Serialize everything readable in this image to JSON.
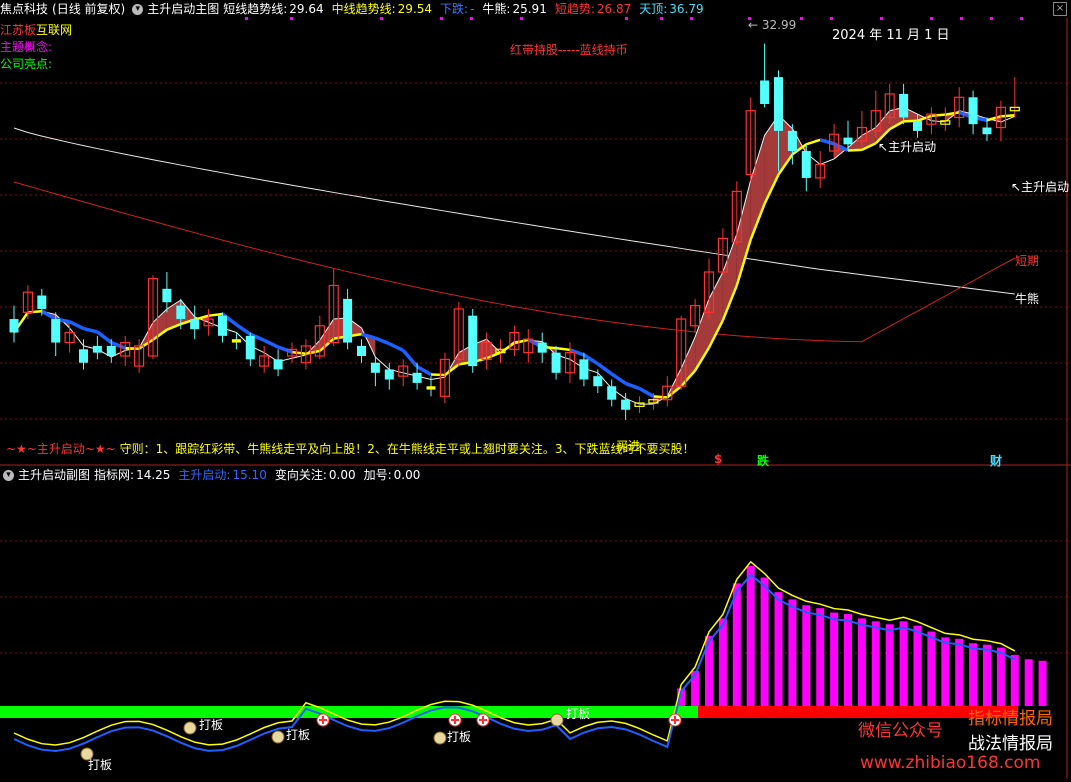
{
  "main_header": {
    "stock_name": "焦点科技",
    "mode": "(日线 前复权)",
    "indicator": "主升启动主图",
    "items": [
      {
        "label": "短线趋势线:",
        "value": "29.64",
        "color": "#ffffff"
      },
      {
        "label": "中线趋势线:",
        "value": "29.54",
        "color": "#ffff00"
      },
      {
        "label": "下跌:",
        "value": "-",
        "color": "#3a78ff"
      },
      {
        "label": "牛熊:",
        "value": "25.91",
        "color": "#ffffff"
      },
      {
        "label": "短趋势:",
        "value": "26.87",
        "color": "#ff3333"
      },
      {
        "label": "天顶:",
        "value": "36.79",
        "color": "#40e0ff"
      }
    ]
  },
  "side_labels": {
    "region_label": "江苏板",
    "region_value": "互联网",
    "theme": "主题概念:",
    "highlight": "公司亮点:"
  },
  "annotations": {
    "top_price": "32.99",
    "date": "2024 年 11 月 1 日",
    "hold_hint": "红带持股-----蓝线持币",
    "start_label_1": "主升启动",
    "start_label_2": "主升启动",
    "short_term": "短期",
    "bull_bear": "牛熊",
    "rule_prefix": "~★~主升启动~★~",
    "rule_text": "守则：1、跟踪红彩带、牛熊线走平及向上股！2、在牛熊线走平或上翘时要关注。3、下跌蓝线时不要买股！",
    "rule_overlay": "买进",
    "marker_dollar": "$",
    "marker_fall": "跌",
    "marker_wealth": "财"
  },
  "sub_header": {
    "indicator": "主升启动副图",
    "items": [
      {
        "label": "指标网:",
        "value": "14.25",
        "color": "#ffffff"
      },
      {
        "label": "主升启动:",
        "value": "15.10",
        "color": "#3366ff"
      },
      {
        "label": "变向关注:",
        "value": "0.00",
        "color": "#ffffff"
      },
      {
        "label": "加号:",
        "value": "0.00",
        "color": "#ffffff"
      }
    ]
  },
  "sub_annotations": {
    "daban": "打板",
    "watermark_1": "微信公众号",
    "watermark_2": "指标情报局",
    "watermark_3": "战法情报局",
    "watermark_url": "www.zhibiao168.com"
  },
  "colors": {
    "up": "#ff3030",
    "down": "#54ffff",
    "yellow": "#ffff00",
    "blue": "#1e60ff",
    "band": "#a53a3a",
    "magenta": "#ff00ff",
    "green_band": "#00ff00",
    "red_band": "#ff0000"
  },
  "chart_data": {
    "type": "candlestick",
    "candles": [
      {
        "o": 29.6,
        "c": 29.2,
        "h": 30.0,
        "l": 28.9
      },
      {
        "o": 29.8,
        "c": 30.4,
        "h": 30.6,
        "l": 29.6
      },
      {
        "o": 30.3,
        "c": 29.9,
        "h": 30.5,
        "l": 29.7
      },
      {
        "o": 29.6,
        "c": 28.9,
        "h": 29.8,
        "l": 28.5
      },
      {
        "o": 28.9,
        "c": 29.2,
        "h": 29.4,
        "l": 28.6
      },
      {
        "o": 28.7,
        "c": 28.3,
        "h": 29.0,
        "l": 28.1
      },
      {
        "o": 28.8,
        "c": 28.6,
        "h": 29.1,
        "l": 28.4
      },
      {
        "o": 28.8,
        "c": 28.5,
        "h": 29.0,
        "l": 28.3
      },
      {
        "o": 28.5,
        "c": 28.9,
        "h": 29.1,
        "l": 28.2
      },
      {
        "o": 28.2,
        "c": 28.8,
        "h": 29.0,
        "l": 28.0
      },
      {
        "o": 28.5,
        "c": 30.8,
        "h": 30.9,
        "l": 28.4
      },
      {
        "o": 30.5,
        "c": 30.1,
        "h": 31.0,
        "l": 29.8
      },
      {
        "o": 30.0,
        "c": 29.6,
        "h": 30.2,
        "l": 29.3
      },
      {
        "o": 29.6,
        "c": 29.3,
        "h": 30.0,
        "l": 29.0
      },
      {
        "o": 29.4,
        "c": 29.6,
        "h": 29.9,
        "l": 29.1
      },
      {
        "o": 29.7,
        "c": 29.1,
        "h": 29.8,
        "l": 28.9
      },
      {
        "o": 29.0,
        "c": 28.9,
        "h": 29.2,
        "l": 28.7
      },
      {
        "o": 29.1,
        "c": 28.4,
        "h": 29.2,
        "l": 28.2
      },
      {
        "o": 28.2,
        "c": 28.5,
        "h": 28.8,
        "l": 28.0
      },
      {
        "o": 28.4,
        "c": 28.1,
        "h": 28.7,
        "l": 27.9
      },
      {
        "o": 28.5,
        "c": 28.7,
        "h": 28.9,
        "l": 28.3
      },
      {
        "o": 28.3,
        "c": 28.8,
        "h": 29.0,
        "l": 28.1
      },
      {
        "o": 28.5,
        "c": 29.4,
        "h": 29.7,
        "l": 28.4
      },
      {
        "o": 28.9,
        "c": 30.6,
        "h": 31.1,
        "l": 28.8
      },
      {
        "o": 30.2,
        "c": 28.9,
        "h": 30.5,
        "l": 28.7
      },
      {
        "o": 28.8,
        "c": 28.5,
        "h": 29.0,
        "l": 28.3
      },
      {
        "o": 28.3,
        "c": 28.0,
        "h": 28.5,
        "l": 27.6
      },
      {
        "o": 28.1,
        "c": 27.8,
        "h": 28.3,
        "l": 27.5
      },
      {
        "o": 27.9,
        "c": 28.2,
        "h": 28.4,
        "l": 27.6
      },
      {
        "o": 28.0,
        "c": 27.7,
        "h": 28.3,
        "l": 27.5
      },
      {
        "o": 27.6,
        "c": 27.5,
        "h": 27.9,
        "l": 27.3
      },
      {
        "o": 27.3,
        "c": 28.4,
        "h": 28.6,
        "l": 27.1
      },
      {
        "o": 28.4,
        "c": 29.9,
        "h": 30.1,
        "l": 28.2
      },
      {
        "o": 29.7,
        "c": 28.2,
        "h": 29.9,
        "l": 28.0
      },
      {
        "o": 28.4,
        "c": 28.9,
        "h": 29.2,
        "l": 28.1
      },
      {
        "o": 28.6,
        "c": 28.7,
        "h": 29.0,
        "l": 28.3
      },
      {
        "o": 28.7,
        "c": 29.2,
        "h": 29.4,
        "l": 28.5
      },
      {
        "o": 28.6,
        "c": 29.0,
        "h": 29.3,
        "l": 28.3
      },
      {
        "o": 28.9,
        "c": 28.6,
        "h": 29.2,
        "l": 28.3
      },
      {
        "o": 28.6,
        "c": 28.0,
        "h": 28.8,
        "l": 27.8
      },
      {
        "o": 28.0,
        "c": 28.6,
        "h": 28.9,
        "l": 27.7
      },
      {
        "o": 28.4,
        "c": 27.8,
        "h": 28.6,
        "l": 27.6
      },
      {
        "o": 27.9,
        "c": 27.6,
        "h": 28.1,
        "l": 27.4
      },
      {
        "o": 27.6,
        "c": 27.2,
        "h": 27.8,
        "l": 27.0
      },
      {
        "o": 27.2,
        "c": 26.9,
        "h": 27.4,
        "l": 26.6
      },
      {
        "o": 27.0,
        "c": 27.1,
        "h": 27.3,
        "l": 26.8
      },
      {
        "o": 27.1,
        "c": 27.2,
        "h": 27.4,
        "l": 26.9
      },
      {
        "o": 27.2,
        "c": 27.6,
        "h": 27.9,
        "l": 27.0
      },
      {
        "o": 27.6,
        "c": 29.6,
        "h": 29.7,
        "l": 27.5
      },
      {
        "o": 29.4,
        "c": 30.0,
        "h": 30.2,
        "l": 29.2
      },
      {
        "o": 29.8,
        "c": 31.0,
        "h": 31.4,
        "l": 29.6
      },
      {
        "o": 31.0,
        "c": 32.0,
        "h": 32.3,
        "l": 30.9
      },
      {
        "o": 31.9,
        "c": 33.4,
        "h": 33.7,
        "l": 31.8
      },
      {
        "o": 33.9,
        "c": 35.8,
        "h": 36.2,
        "l": 33.7
      },
      {
        "o": 36.7,
        "c": 36.0,
        "h": 37.8,
        "l": 35.9
      },
      {
        "o": 36.8,
        "c": 35.2,
        "h": 37.0,
        "l": 34.0
      },
      {
        "o": 35.2,
        "c": 34.6,
        "h": 35.4,
        "l": 34.2
      },
      {
        "o": 34.6,
        "c": 33.8,
        "h": 34.8,
        "l": 33.4
      },
      {
        "o": 33.8,
        "c": 34.2,
        "h": 34.6,
        "l": 33.5
      },
      {
        "o": 34.6,
        "c": 35.1,
        "h": 35.4,
        "l": 34.4
      },
      {
        "o": 35.0,
        "c": 34.8,
        "h": 35.5,
        "l": 34.6
      },
      {
        "o": 34.9,
        "c": 35.3,
        "h": 35.8,
        "l": 34.7
      },
      {
        "o": 35.2,
        "c": 35.8,
        "h": 36.4,
        "l": 35.0
      },
      {
        "o": 35.6,
        "c": 36.3,
        "h": 36.6,
        "l": 35.4
      },
      {
        "o": 36.3,
        "c": 35.6,
        "h": 36.6,
        "l": 35.4
      },
      {
        "o": 35.5,
        "c": 35.2,
        "h": 35.7,
        "l": 35.0
      },
      {
        "o": 35.4,
        "c": 35.7,
        "h": 35.9,
        "l": 35.1
      },
      {
        "o": 35.4,
        "c": 35.5,
        "h": 35.9,
        "l": 35.2
      },
      {
        "o": 35.6,
        "c": 36.2,
        "h": 36.5,
        "l": 35.3
      },
      {
        "o": 36.2,
        "c": 35.4,
        "h": 36.4,
        "l": 35.1
      },
      {
        "o": 35.3,
        "c": 35.1,
        "h": 35.6,
        "l": 34.9
      },
      {
        "o": 35.3,
        "c": 35.9,
        "h": 36.1,
        "l": 34.9
      },
      {
        "o": 35.8,
        "c": 35.9,
        "h": 36.8,
        "l": 35.6
      }
    ],
    "sub_bars": [
      0,
      0,
      0,
      0,
      0,
      0,
      0,
      0,
      0,
      0,
      0,
      0,
      0,
      0,
      0,
      0,
      0,
      0,
      0,
      0,
      0,
      0,
      0,
      0,
      0,
      0,
      0,
      0,
      0,
      0,
      0,
      0,
      0,
      0,
      0,
      0,
      0,
      0,
      0,
      0,
      0,
      0,
      0,
      0,
      0,
      0,
      0,
      0,
      1.2,
      2.4,
      4.8,
      6.0,
      8.4,
      9.6,
      8.8,
      7.8,
      7.3,
      6.9,
      6.7,
      6.4,
      6.3,
      6.0,
      5.8,
      5.6,
      5.8,
      5.5,
      5.1,
      4.7,
      4.6,
      4.3,
      4.2,
      4.0,
      3.5,
      3.2,
      3.1
    ]
  }
}
